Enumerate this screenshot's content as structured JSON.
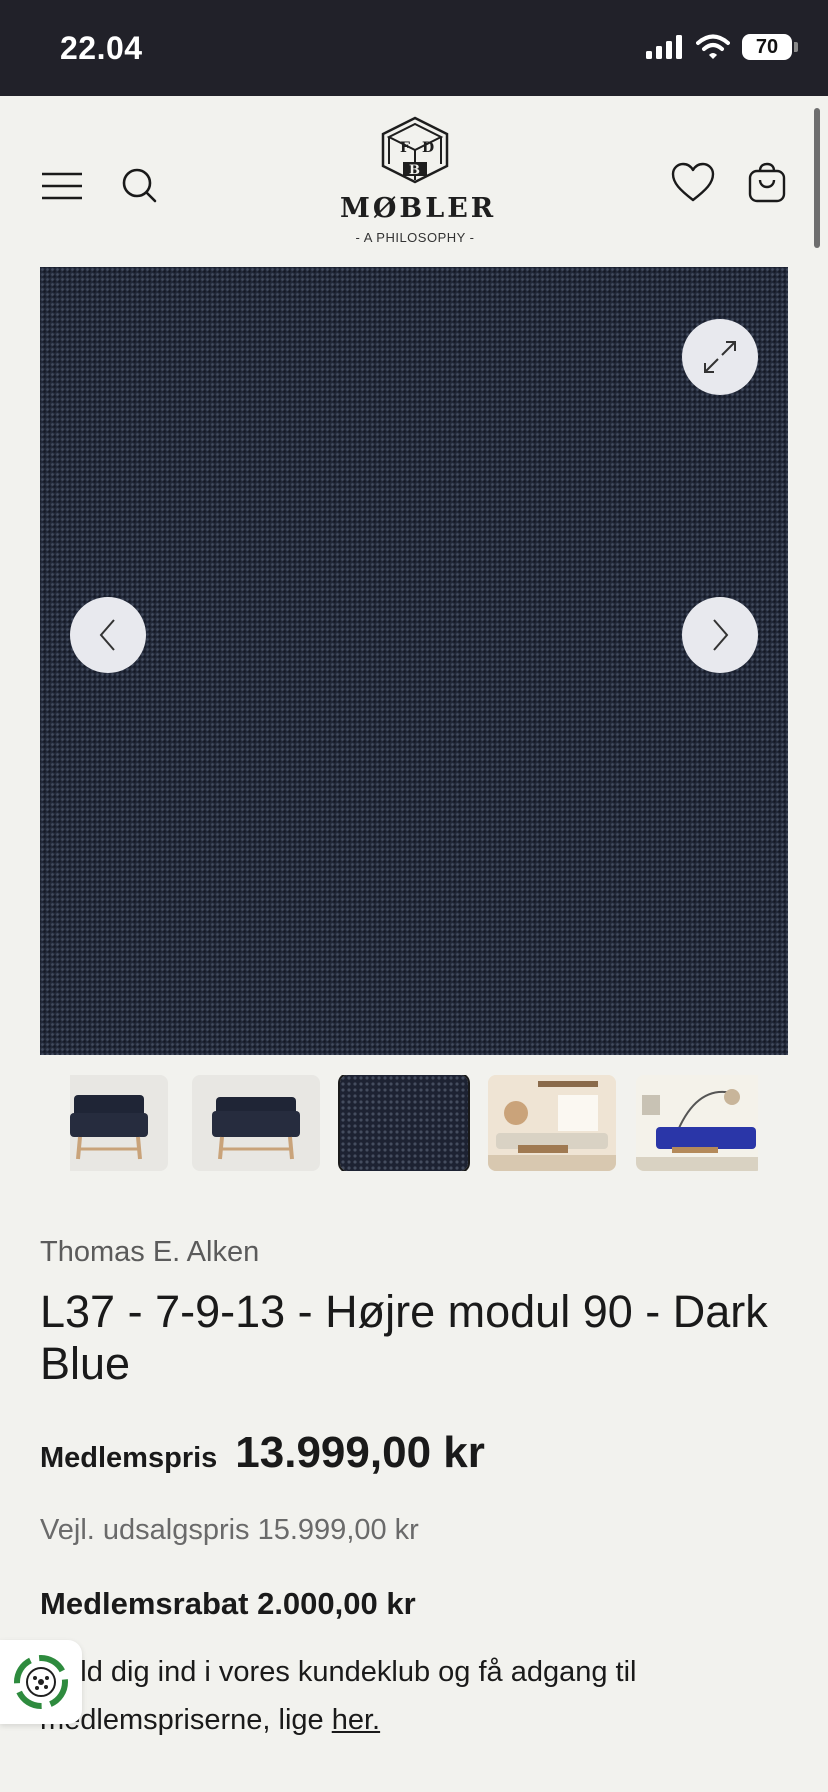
{
  "status_bar": {
    "time": "22.04",
    "battery": "70"
  },
  "header": {
    "logo_word": "MØBLER",
    "logo_tagline": "- A PHILOSOPHY -",
    "logo_letters": [
      "F",
      "D",
      "B"
    ]
  },
  "gallery": {
    "thumbnails": [
      "chair-front",
      "chair-back",
      "fabric-swatch",
      "living-room",
      "blue-sofa-room"
    ],
    "selected_index": 2
  },
  "product": {
    "brand": "Thomas E. Alken",
    "title": "L37 - 7-9-13 - Højre modul 90 - Dark Blue",
    "member_price_label": "Medlemspris",
    "member_price": "13.999,00 kr",
    "rrp": "Vejl. udsalgspris 15.999,00 kr",
    "member_discount": "Medlemsrabat 2.000,00 kr",
    "signup_text": "Meld dig ind i vores kundeklub og få adgang til medlemspriserne, lige ",
    "signup_link": "her."
  },
  "colors": {
    "status_bg": "#212129",
    "page_bg": "#f2f2ee",
    "fabric": "#22293a"
  }
}
